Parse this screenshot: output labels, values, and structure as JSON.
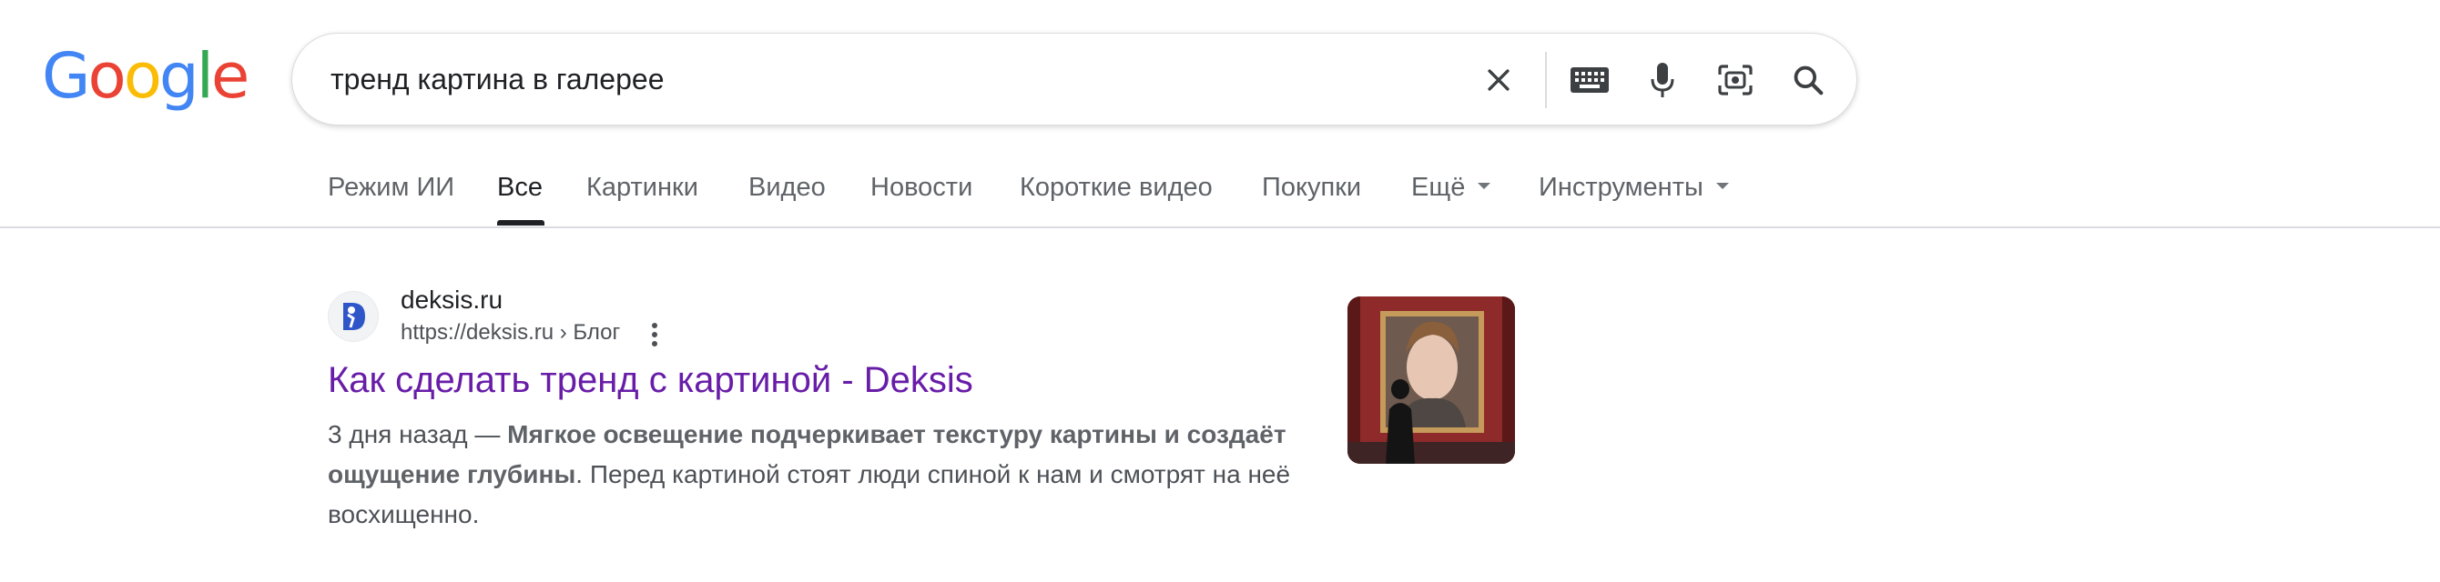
{
  "logo": {
    "letters": [
      "G",
      "o",
      "o",
      "g",
      "l",
      "e"
    ],
    "colors": [
      "#4285F4",
      "#EA4335",
      "#FBBC05",
      "#4285F4",
      "#34A853",
      "#EA4335"
    ]
  },
  "search": {
    "query": "тренд картина в галерее"
  },
  "icons": {
    "clear": "close-icon",
    "keyboard": "keyboard-icon",
    "voice": "microphone-icon",
    "lens": "camera-lens-icon",
    "search": "search-icon"
  },
  "tabs": [
    {
      "label": "Режим ИИ"
    },
    {
      "label": "Все",
      "active": true
    },
    {
      "label": "Картинки"
    },
    {
      "label": "Видео"
    },
    {
      "label": "Новости"
    },
    {
      "label": "Короткие видео"
    },
    {
      "label": "Покупки"
    },
    {
      "label": "Ещё",
      "dropdown": true
    }
  ],
  "tools": {
    "label": "Инструменты"
  },
  "result": {
    "site_name": "deksis.ru",
    "url": "https://deksis.ru › Блог",
    "title": "Как сделать тренд с картиной - Deksis",
    "date": "3 дня назад — ",
    "bold": "Мягкое освещение подчеркивает текстуру картины и создаёт ощущение глубины",
    "rest": ". Перед картиной стоят люди спиной к нам и смотрят на неё восхищенно."
  },
  "colors": {
    "link_visited": "#681da8",
    "text": "#202124",
    "muted": "#5f6368"
  }
}
